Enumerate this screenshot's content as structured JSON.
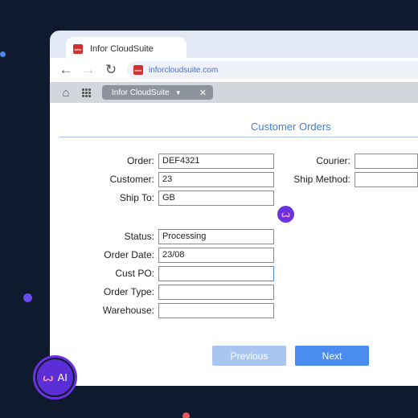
{
  "browser": {
    "tab_title": "Infor CloudSuite",
    "favicon_text": "infor",
    "url": "inforcloudsuite.com",
    "nav_icons": [
      "back-arrow-icon",
      "forward-arrow-icon",
      "reload-icon"
    ]
  },
  "app_toolbar": {
    "icons": [
      "home-icon",
      "apps-grid-icon"
    ],
    "tab_label": "Infor CloudSuite",
    "tab_caret": "▼",
    "tab_close": "✕"
  },
  "form": {
    "title": "Customer Orders",
    "fields": {
      "order": {
        "label": "Order:",
        "value": "DEF4321"
      },
      "customer": {
        "label": "Customer:",
        "value": "23"
      },
      "ship_to": {
        "label": "Ship To:",
        "value": "GB"
      },
      "courier": {
        "label": "Courier:",
        "value": ""
      },
      "ship_method": {
        "label": "Ship Method:",
        "value": ""
      },
      "status": {
        "label": "Status:",
        "value": "Processing"
      },
      "order_date": {
        "label": "Order Date:",
        "value": "23/08"
      },
      "cust_po": {
        "label": "Cust PO:",
        "value": ""
      },
      "order_type": {
        "label": "Order Type:",
        "value": ""
      },
      "warehouse": {
        "label": "Warehouse:",
        "value": ""
      }
    },
    "previous_label": "Previous",
    "next_label": "Next"
  },
  "ai_assistant": {
    "label": "AI",
    "symbol": "ꙍ"
  },
  "colors": {
    "background": "#0f1a2e",
    "accent_blue": "#3f7fdc",
    "ai_purple": "#6b31e0",
    "button_next": "#4a8cf0",
    "button_previous_disabled": "#a9c6f2"
  }
}
